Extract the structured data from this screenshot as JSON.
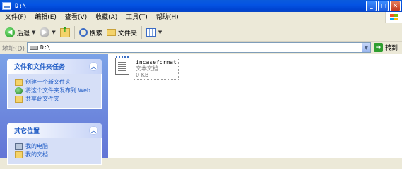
{
  "window": {
    "title": "D:\\"
  },
  "menu": [
    "文件(F)",
    "编辑(E)",
    "查看(V)",
    "收藏(A)",
    "工具(T)",
    "帮助(H)"
  ],
  "toolbar": {
    "back": "后退",
    "search": "搜索",
    "folders": "文件夹"
  },
  "address": {
    "label": "地址(D)",
    "value": "D:\\",
    "go": "转到"
  },
  "tasks_panel": {
    "title": "文件和文件夹任务",
    "items": [
      "创建一个新文件夹",
      "将这个文件夹发布到 Web",
      "共享此文件夹"
    ]
  },
  "places_panel": {
    "title": "其它位置",
    "items": [
      "我的电脑",
      "我的文档"
    ]
  },
  "file": {
    "name": "incaseformat",
    "type": "文本文档",
    "size": "0 KB"
  }
}
